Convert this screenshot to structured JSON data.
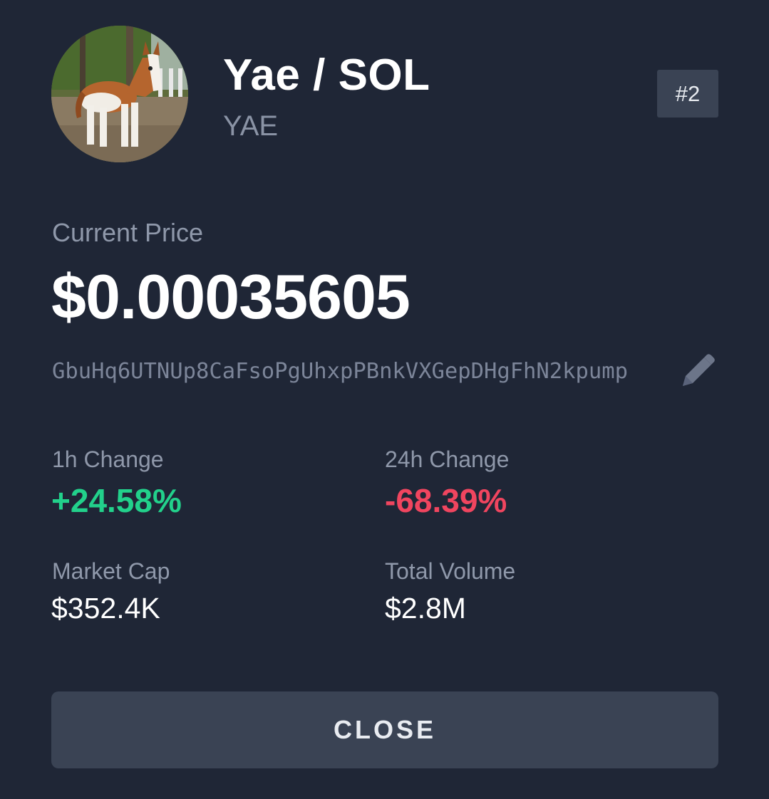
{
  "token": {
    "name_pair": "Yae / SOL",
    "symbol": "YAE",
    "rank": "#2",
    "avatar": "pony-photo"
  },
  "price": {
    "label": "Current Price",
    "value": "$0.00035605"
  },
  "contract": {
    "address": "GbuHq6UTNUp8CaFsoPgUhxpPBnkVXGepDHgFhN2kpump",
    "edit_icon": "pencil-icon"
  },
  "stats": {
    "change_1h": {
      "label": "1h Change",
      "value": "+24.58%",
      "color": "#22d18b"
    },
    "change_24h": {
      "label": "24h Change",
      "value": "-68.39%",
      "color": "#f0455f"
    },
    "market_cap": {
      "label": "Market Cap",
      "value": "$352.4K"
    },
    "total_volume": {
      "label": "Total Volume",
      "value": "$2.8M"
    }
  },
  "actions": {
    "close_label": "CLOSE"
  },
  "colors": {
    "background": "#1f2636",
    "button_bg": "#3a4354",
    "muted_text": "#8f98aa"
  }
}
